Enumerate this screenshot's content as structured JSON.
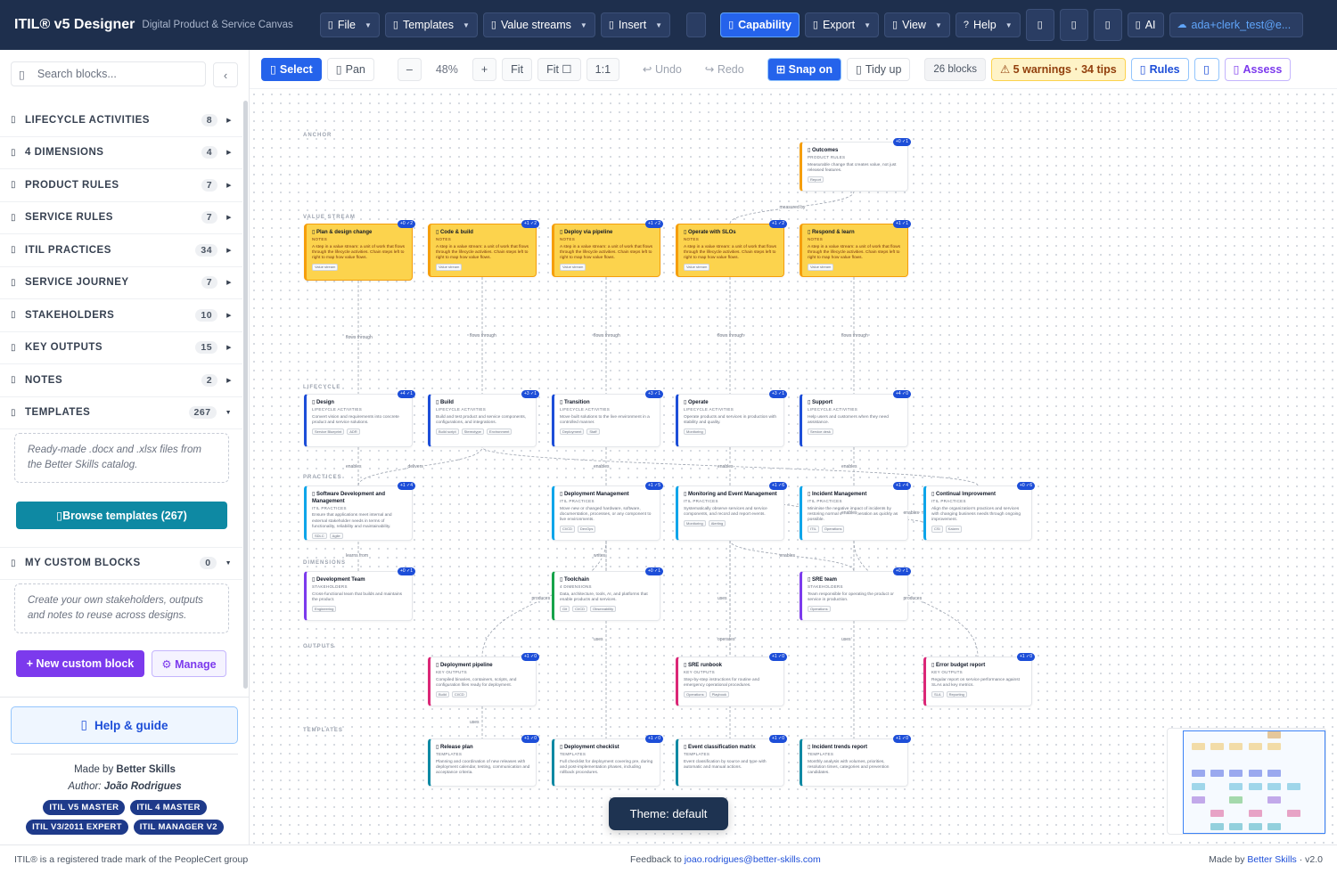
{
  "app": {
    "title": "ITIL® v5 Designer",
    "subtitle": "Digital Product & Service Canvas"
  },
  "topbar": {
    "file": "File",
    "templates": "Templates",
    "value_streams": "Value streams",
    "insert": "Insert",
    "capability": "Capability",
    "export": "Export",
    "view": "View",
    "help": "Help",
    "ai": "AI",
    "user": "ada+clerk_test@e..."
  },
  "sidebar": {
    "search_placeholder": "Search blocks...",
    "collapse": "‹",
    "categories": [
      {
        "name": "LIFECYCLE ACTIVITIES",
        "count": "8"
      },
      {
        "name": "4 DIMENSIONS",
        "count": "4"
      },
      {
        "name": "PRODUCT RULES",
        "count": "7"
      },
      {
        "name": "SERVICE RULES",
        "count": "7"
      },
      {
        "name": "ITIL PRACTICES",
        "count": "34"
      },
      {
        "name": "SERVICE JOURNEY",
        "count": "7"
      },
      {
        "name": "STAKEHOLDERS",
        "count": "10"
      },
      {
        "name": "KEY OUTPUTS",
        "count": "15"
      },
      {
        "name": "NOTES",
        "count": "2"
      },
      {
        "name": "TEMPLATES",
        "count": "267"
      }
    ],
    "templates_info": "Ready-made .docx and .xlsx files from the Better Skills catalog.",
    "browse_templates": "Browse templates (267)",
    "custom_blocks": {
      "name": "MY CUSTOM BLOCKS",
      "count": "0"
    },
    "custom_info": "Create your own stakeholders, outputs and notes to reuse across designs.",
    "new_custom_block": "+ New custom block",
    "manage": "⚙ Manage",
    "help_guide": "Help & guide",
    "made_by_prefix": "Made by",
    "made_by": "Better Skills",
    "author_prefix": "Author:",
    "author": "João Rodrigues",
    "badges": [
      "ITIL V5 MASTER",
      "ITIL 4 MASTER",
      "ITIL V3/2011 EXPERT",
      "ITIL MANAGER V2"
    ]
  },
  "canvas_toolbar": {
    "select": "Select",
    "pan": "Pan",
    "zoom_out": "–",
    "zoom": "48%",
    "zoom_in": "+",
    "fit": "Fit",
    "fit_box": "Fit ☐",
    "one_to_one": "1:1",
    "undo": "↩ Undo",
    "redo": "↪ Redo",
    "snap": "⊞ Snap on",
    "tidy": "Tidy up",
    "blocks": "26 blocks",
    "warnings": "⚠  5 warnings · 34 tips",
    "rules": "Rules",
    "assess": "Assess"
  },
  "canvas": {
    "rows": [
      "ANCHOR",
      "VALUE STREAM",
      "LIFECYCLE",
      "PRACTICES",
      "DIMENSIONS",
      "OUTPUTS",
      "TEMPLATES"
    ],
    "nodes": [
      {
        "title": "Outcomes",
        "sub": "PRODUCT RULES",
        "body": "Measurable change that creates value, not just released features.",
        "tags": [
          "Report"
        ],
        "score": "+0 ✓1",
        "color": "#f59e0b"
      },
      {
        "title": "Plan & design change",
        "sub": "NOTES",
        "body": "A step in a value stream: a unit of work that flows through the lifecycle activities. Chain steps left to right to map how value flows.",
        "tags": [
          "Value stream"
        ],
        "score": "+0 ✓2",
        "color": "#f59e0b"
      },
      {
        "title": "Code & build",
        "sub": "NOTES",
        "body": "A step in a value stream: a unit of work that flows through the lifecycle activities. Chain steps left to right to map how value flows.",
        "tags": [
          "Value stream"
        ],
        "score": "+1 ✓2",
        "color": "#f59e0b"
      },
      {
        "title": "Deploy via pipeline",
        "sub": "NOTES",
        "body": "A step in a value stream: a unit of work that flows through the lifecycle activities. Chain steps left to right to map how value flows.",
        "tags": [
          "Value stream"
        ],
        "score": "+1 ✓2",
        "color": "#f59e0b"
      },
      {
        "title": "Operate with SLOs",
        "sub": "NOTES",
        "body": "A step in a value stream: a unit of work that flows through the lifecycle activities. Chain steps left to right to map how value flows.",
        "tags": [
          "Value stream"
        ],
        "score": "+1 ✓2",
        "color": "#f59e0b"
      },
      {
        "title": "Respond & learn",
        "sub": "NOTES",
        "body": "A step in a value stream: a unit of work that flows through the lifecycle activities. Chain steps left to right to map how value flows.",
        "tags": [
          "Value stream"
        ],
        "score": "+1 ✓1",
        "color": "#f59e0b"
      },
      {
        "title": "Design",
        "sub": "LIFECYCLE ACTIVITIES",
        "body": "Convert vision and requirements into concrete product and service solutions.",
        "tags": [
          "Service Blueprint",
          "ADR"
        ],
        "score": "+4 ✓1",
        "color": "#1d4ed8"
      },
      {
        "title": "Build",
        "sub": "LIFECYCLE ACTIVITIES",
        "body": "Build and test product and service components, configurations, and integrations.",
        "tags": [
          "Build script",
          "Stereotype",
          "Environment"
        ],
        "score": "+3 ✓1",
        "color": "#1d4ed8"
      },
      {
        "title": "Transition",
        "sub": "LIFECYCLE ACTIVITIES",
        "body": "Move built solutions to the live environment in a controlled manner.",
        "tags": [
          "Deployment",
          "Staff"
        ],
        "score": "+3 ✓1",
        "color": "#1d4ed8"
      },
      {
        "title": "Operate",
        "sub": "LIFECYCLE ACTIVITIES",
        "body": "Operate products and services in production with stability and quality.",
        "tags": [
          "Monitoring"
        ],
        "score": "+3 ✓1",
        "color": "#1d4ed8"
      },
      {
        "title": "Support",
        "sub": "LIFECYCLE ACTIVITIES",
        "body": "Help users and customers when they need assistance.",
        "tags": [
          "Service desk"
        ],
        "score": "+4 ✓0",
        "color": "#1d4ed8"
      },
      {
        "title": "Software Development and Management",
        "sub": "ITIL PRACTICES",
        "body": "Ensure that applications meet internal and external stakeholder needs in terms of functionality, reliability and maintainability.",
        "tags": [
          "SDLC",
          "Agile"
        ],
        "score": "+1 ✓4",
        "color": "#0ea5e9"
      },
      {
        "title": "Deployment Management",
        "sub": "ITIL PRACTICES",
        "body": "Move new or changed hardware, software, documentation, processes, or any component to live environments.",
        "tags": [
          "CI/CD",
          "DevOps"
        ],
        "score": "+1 ✓5",
        "color": "#0ea5e9"
      },
      {
        "title": "Monitoring and Event Management",
        "sub": "ITIL PRACTICES",
        "body": "Systematically observe services and service components, and record and report events.",
        "tags": [
          "Monitoring",
          "Alerting"
        ],
        "score": "+1 ✓6",
        "color": "#0ea5e9"
      },
      {
        "title": "Incident Management",
        "sub": "ITIL PRACTICES",
        "body": "Minimise the negative impact of incidents by restoring normal service operation as quickly as possible.",
        "tags": [
          "ITIL",
          "Operations"
        ],
        "score": "+1 ✓4",
        "color": "#0ea5e9"
      },
      {
        "title": "Continual Improvement",
        "sub": "ITIL PRACTICES",
        "body": "Align the organization's practices and services with changing business needs through ongoing improvement.",
        "tags": [
          "CSI",
          "Kaizen"
        ],
        "score": "+0 ✓6",
        "color": "#0ea5e9"
      },
      {
        "title": "Development Team",
        "sub": "STAKEHOLDERS",
        "body": "Cross-functional team that builds and maintains the product.",
        "tags": [
          "Engineering"
        ],
        "score": "+0 ✓1",
        "color": "#7c3aed"
      },
      {
        "title": "Toolchain",
        "sub": "4 DIMENSIONS",
        "body": "Data, architecture, tools, AI, and platforms that enable products and services.",
        "tags": [
          "Git",
          "CI/CD",
          "Observability"
        ],
        "score": "+0 ✓1",
        "color": "#16a34a"
      },
      {
        "title": "SRE team",
        "sub": "STAKEHOLDERS",
        "body": "Team responsible for operating the product or service in production.",
        "tags": [
          "Operations"
        ],
        "score": "+0 ✓1",
        "color": "#7c3aed"
      },
      {
        "title": "Deployment pipeline",
        "sub": "KEY OUTPUTS",
        "body": "Compiled binaries, containers, scripts, and configuration files ready for deployment.",
        "tags": [
          "Build",
          "CI/CD"
        ],
        "score": "+1 ✓0",
        "color": "#db2777"
      },
      {
        "title": "SRE runbook",
        "sub": "KEY OUTPUTS",
        "body": "Step-by-step instructions for routine and emergency operational procedures.",
        "tags": [
          "Operations",
          "Playbook"
        ],
        "score": "+1 ✓0",
        "color": "#db2777"
      },
      {
        "title": "Error budget report",
        "sub": "KEY OUTPUTS",
        "body": "Regular report on service performance against SLAs and key metrics.",
        "tags": [
          "SLA",
          "Reporting"
        ],
        "score": "+1 ✓0",
        "color": "#db2777"
      },
      {
        "title": "Release plan",
        "sub": "TEMPLATES",
        "body": "Planning and coordination of new releases with deployment calendar, testing, communication and acceptance criteria.",
        "tags": [],
        "score": "+1 ✓0",
        "color": "#0e89a3"
      },
      {
        "title": "Deployment checklist",
        "sub": "TEMPLATES",
        "body": "Full checklist for deployment covering pre, during and post-implementation phases, including rollback procedures.",
        "tags": [],
        "score": "+1 ✓0",
        "color": "#0e89a3"
      },
      {
        "title": "Event classification matrix",
        "sub": "TEMPLATES",
        "body": "Event classification by source and type with automatic and manual actions.",
        "tags": [],
        "score": "+1 ✓0",
        "color": "#0e89a3"
      },
      {
        "title": "Incident trends report",
        "sub": "TEMPLATES",
        "body": "Monthly analysis with volumes, priorities, resolution times, categories and prevention candidates.",
        "tags": [],
        "score": "+1 ✓0",
        "color": "#0e89a3"
      }
    ],
    "edge_labels": [
      "flows through",
      "flows through",
      "flows through",
      "flows through",
      "flows through",
      "measured by",
      "enables",
      "delivers",
      "enables",
      "enables",
      "enables",
      "enables",
      "enables",
      "enables",
      "learns from",
      "writes",
      "enables",
      "produces",
      "uses",
      "produces",
      "uses",
      "uses",
      "operates",
      "uses"
    ]
  },
  "theme_toast": "Theme: default",
  "footer": {
    "left": "ITIL® is a registered trade mark of the PeopleCert group",
    "feedback_prefix": "Feedback to",
    "feedback_email": "joao.rodrigues@better-skills.com",
    "made_by_prefix": "Made by",
    "made_by_link": "Better Skills",
    "version": " · v2.0"
  },
  "icons": {
    "search": "search-icon",
    "collapse": "chevron-left-icon",
    "help": "book-icon"
  }
}
